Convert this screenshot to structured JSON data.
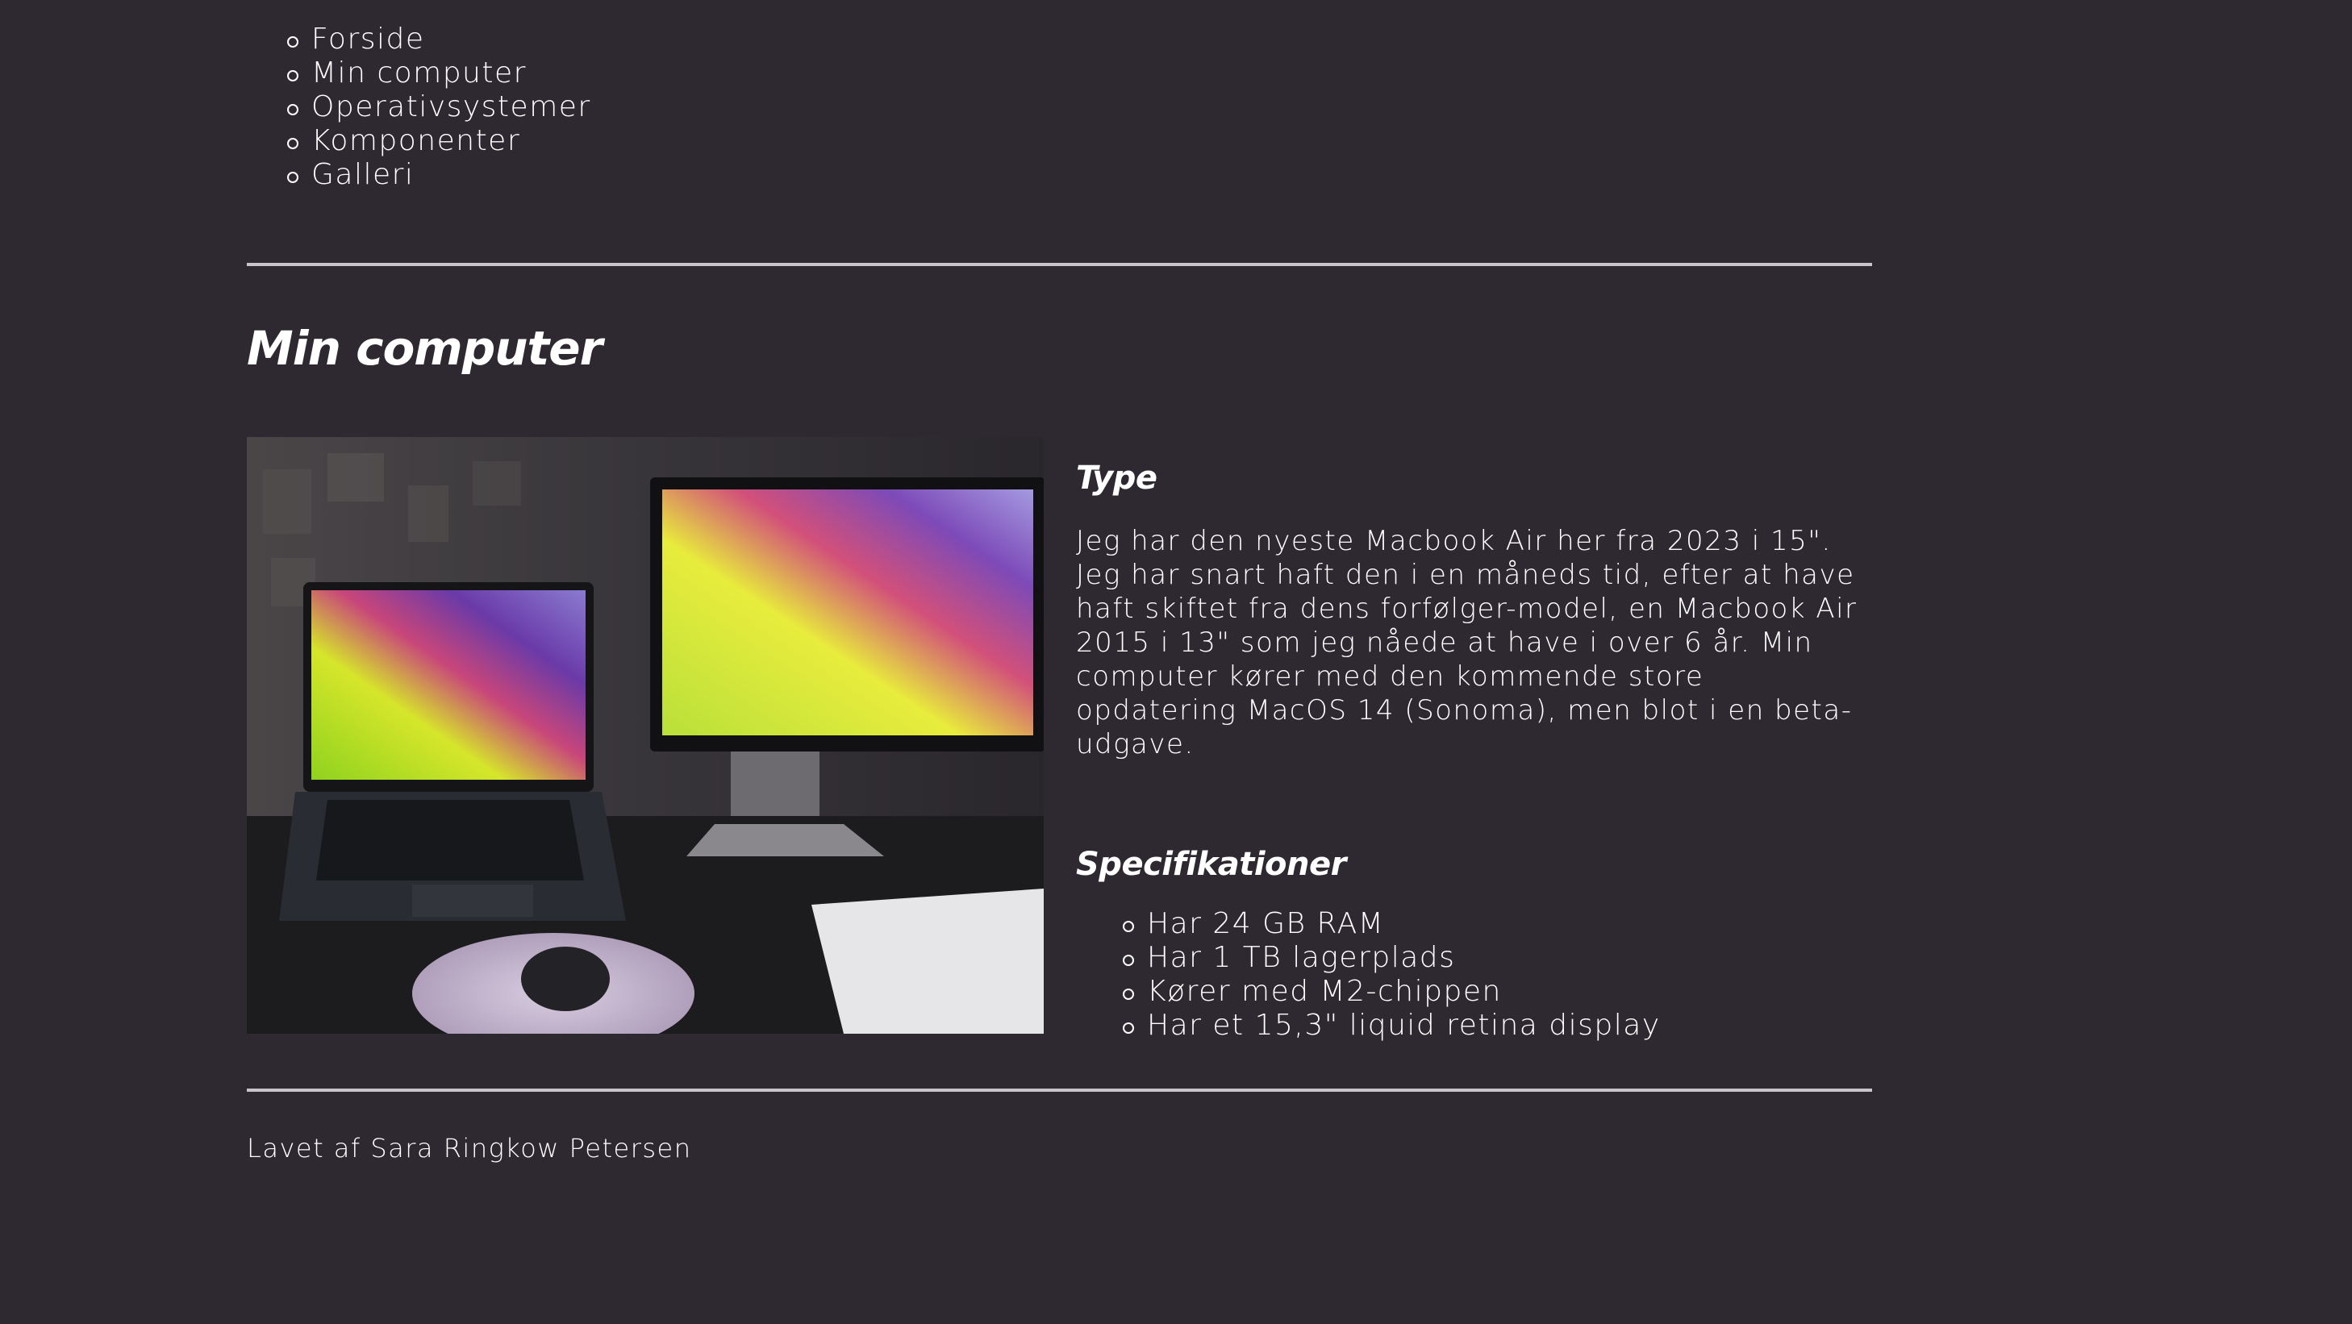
{
  "nav": {
    "items": [
      {
        "label": "Forside"
      },
      {
        "label": "Min computer"
      },
      {
        "label": "Operativsystemer"
      },
      {
        "label": "Komponenter"
      },
      {
        "label": "Galleri"
      }
    ]
  },
  "main": {
    "title": "Min computer",
    "type_heading": "Type",
    "type_text": "Jeg har den nyeste Macbook Air her fra 2023 i 15\". Jeg har snart haft den i en måneds tid, efter at have haft skiftet fra dens forfølger-model, en Macbook Air 2015 i 13\" som jeg nåede at have i over 6 år. Min computer kører med den kommende store opdatering MacOS 14 (Sonoma), men blot i en beta-udgave.",
    "spec_heading": "Specifikationer",
    "specs": [
      "Har 24 GB RAM",
      "Har 1 TB lagerplads",
      "Kører med M2-chippen",
      "Har et 15,3\" liquid retina display"
    ]
  },
  "footer": {
    "credit": "Lavet af Sara Ringkow Petersen"
  },
  "colors": {
    "background": "#2e2930",
    "text": "#ffffff",
    "rule": "#c9c4c9"
  }
}
